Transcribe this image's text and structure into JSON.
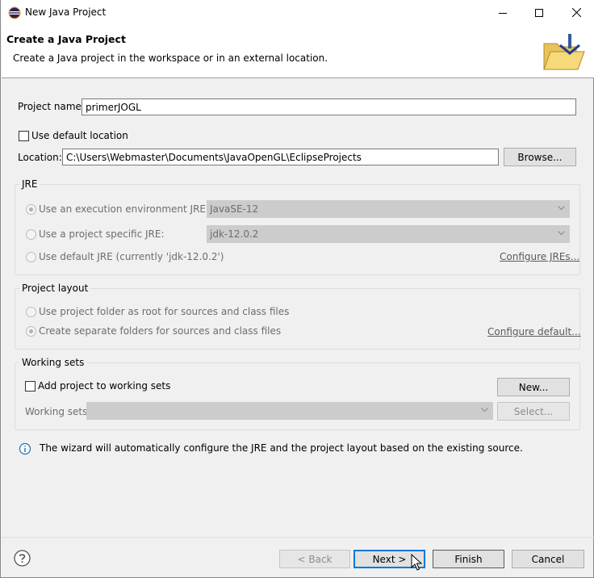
{
  "window": {
    "title": "New Java Project"
  },
  "header": {
    "title": "Create a Java Project",
    "description": "Create a Java project in the workspace or in an external location."
  },
  "form": {
    "project_name_label": "Project name:",
    "project_name_value": "primerJOGL",
    "use_default_location_label": "Use default location",
    "use_default_location_checked": false,
    "location_label": "Location:",
    "location_value": "C:\\Users\\Webmaster\\Documents\\JavaOpenGL\\EclipseProjects",
    "browse_label": "Browse..."
  },
  "jre": {
    "group_label": "JRE",
    "exec_env_label": "Use an execution environment JRE:",
    "exec_env_value": "JavaSE-12",
    "project_specific_label": "Use a project specific JRE:",
    "project_specific_value": "jdk-12.0.2",
    "default_jre_label": "Use default JRE (currently 'jdk-12.0.2')",
    "configure_link": "Configure JREs..."
  },
  "layout": {
    "group_label": "Project layout",
    "option1_label": "Use project folder as root for sources and class files",
    "option2_label": "Create separate folders for sources and class files",
    "configure_link": "Configure default..."
  },
  "working_sets": {
    "group_label": "Working sets",
    "add_label": "Add project to working sets",
    "new_label": "New...",
    "sets_label": "Working sets:",
    "sets_value": "",
    "select_label": "Select..."
  },
  "info": {
    "message": "The wizard will automatically configure the JRE and the project layout based on the existing source."
  },
  "footer": {
    "back_label": "< Back",
    "next_label": "Next >",
    "finish_label": "Finish",
    "cancel_label": "Cancel"
  },
  "icons": {
    "app": "eclipse-icon",
    "help": "help-icon",
    "info": "info-icon",
    "header": "folder-icon"
  },
  "colors": {
    "focus_blue": "#0078d7",
    "info_blue": "#1f6fb5"
  }
}
